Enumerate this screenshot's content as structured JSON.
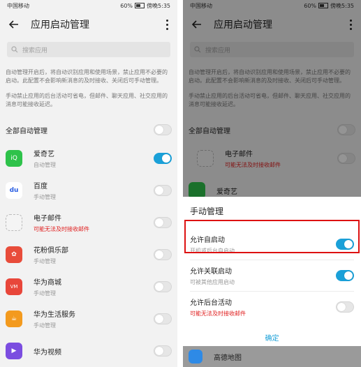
{
  "status": {
    "left": "中国移动",
    "battery": "60%",
    "time": "傍晚5:35"
  },
  "appbar": {
    "title": "应用启动管理"
  },
  "search": {
    "placeholder": "搜索应用"
  },
  "desc": {
    "p1": "自动管理开启后，将自动识别应用和使用场景，禁止应用不必要的启动。此配置不会影响新消息的及时接收、关闭后可手动管理。",
    "p2": "手动禁止应用的后台活动可省电，但邮件、聊天应用、社交应用的消息可能接收延迟。"
  },
  "all_auto": {
    "label": "全部自动管理",
    "on": false
  },
  "apps": [
    {
      "name": "爱奇艺",
      "sub": "自动管理",
      "warn": false,
      "on": true,
      "icon": "iqiyi-icon",
      "color": "#2ec24a",
      "glyph": "iQ"
    },
    {
      "name": "百度",
      "sub": "手动管理",
      "warn": false,
      "on": false,
      "icon": "baidu-icon",
      "color": "#2b5fe3",
      "glyph": "du"
    },
    {
      "name": "电子邮件",
      "sub": "可能无法及时接收邮件",
      "warn": true,
      "on": false,
      "icon": "email-icon",
      "color": "#ededed",
      "glyph": ""
    },
    {
      "name": "花粉俱乐部",
      "sub": "手动管理",
      "warn": false,
      "on": false,
      "icon": "huafen-icon",
      "color": "#e84c3a",
      "glyph": "✿"
    },
    {
      "name": "华为商城",
      "sub": "手动管理",
      "warn": false,
      "on": false,
      "icon": "vmall-icon",
      "color": "#e8463a",
      "glyph": "VM"
    },
    {
      "name": "华为生活服务",
      "sub": "手动管理",
      "warn": false,
      "on": false,
      "icon": "life-service-icon",
      "color": "#f39a1e",
      "glyph": "☕"
    },
    {
      "name": "华为视频",
      "sub": "",
      "warn": false,
      "on": false,
      "icon": "video-icon",
      "color": "#7b4de0",
      "glyph": "▶"
    }
  ],
  "right_bg": [
    {
      "name": "电子邮件",
      "sub": "可能无法及时接收邮件",
      "warn": true
    },
    {
      "name": "爱奇艺",
      "sub": "",
      "warn": false
    }
  ],
  "sheet": {
    "title": "手动管理",
    "items": [
      {
        "name": "允许自启动",
        "sub": "开机或后台自启动",
        "warn": false,
        "on": true
      },
      {
        "name": "允许关联启动",
        "sub": "可被其他应用启动",
        "warn": false,
        "on": true
      },
      {
        "name": "允许后台活动",
        "sub": "可能无法及时接收邮件",
        "warn": true,
        "on": false
      }
    ],
    "ok": "确定"
  },
  "right_bottom_app": {
    "name": "高德地图"
  }
}
